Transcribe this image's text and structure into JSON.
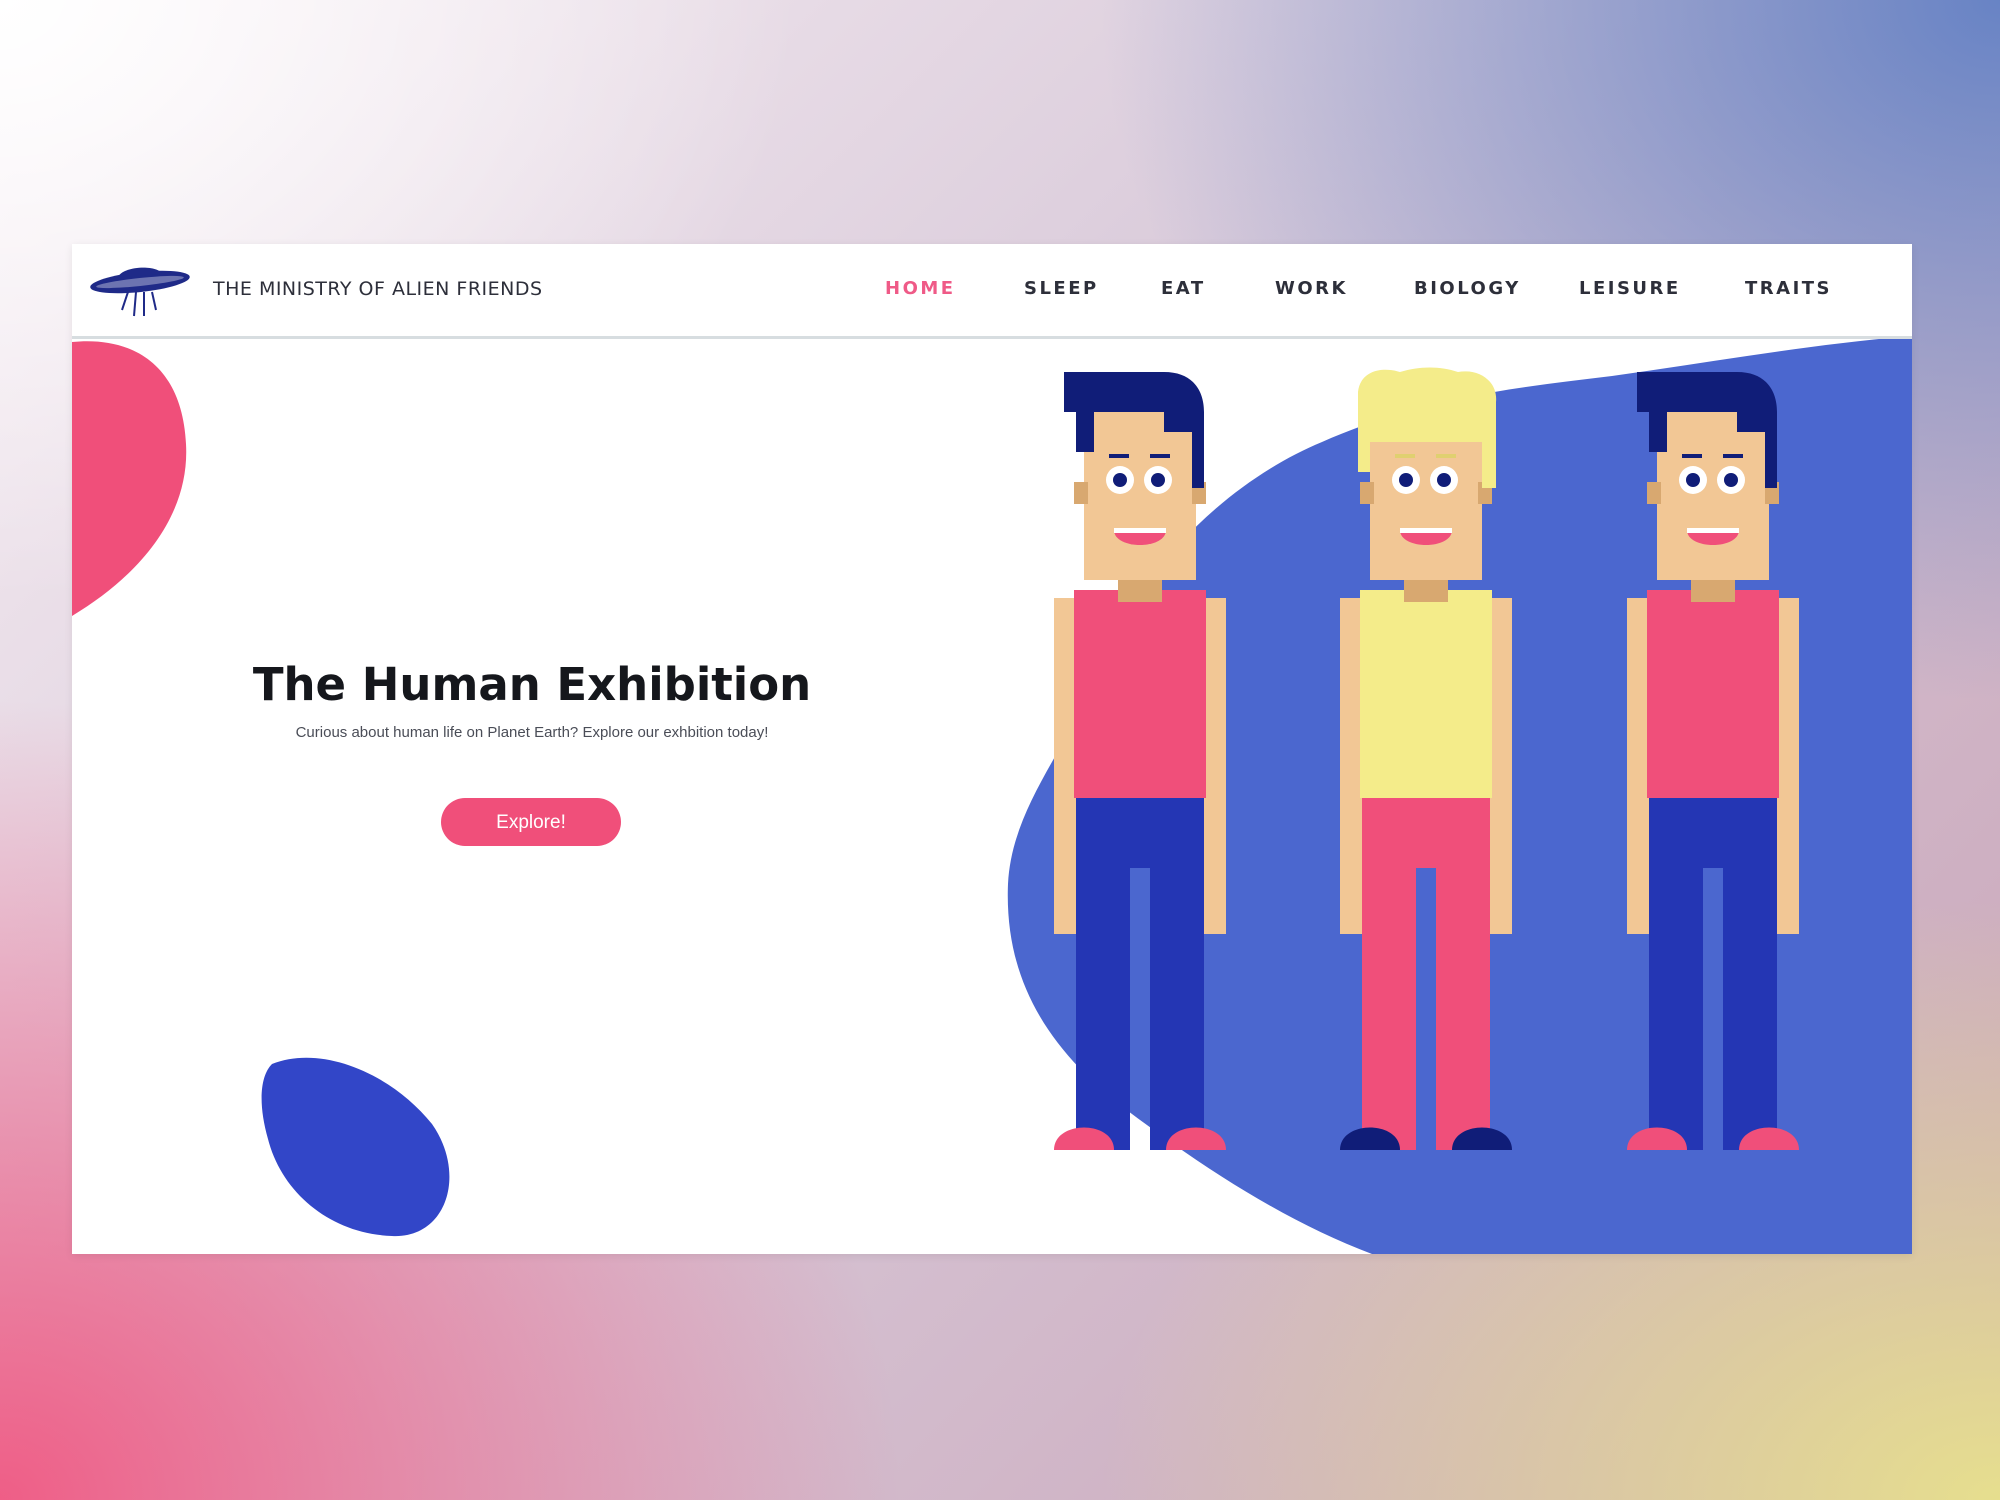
{
  "brand": {
    "name": "THE MINISTRY OF ALIEN FRIENDS",
    "logo_icon": "ufo-icon"
  },
  "nav": {
    "items": [
      {
        "label": "HOME",
        "active": true
      },
      {
        "label": "SLEEP",
        "active": false
      },
      {
        "label": "EAT",
        "active": false
      },
      {
        "label": "WORK",
        "active": false
      },
      {
        "label": "BIOLOGY",
        "active": false
      },
      {
        "label": "LEISURE",
        "active": false
      },
      {
        "label": "TRAITS",
        "active": false
      }
    ]
  },
  "hero": {
    "title": "The Human Exhibition",
    "subtitle": "Curious about human life on Planet Earth? Explore our exhbition today!",
    "cta_label": "Explore!"
  },
  "colors": {
    "accent": "#ef5a87",
    "blue_blob": "#4b67cf",
    "pink_blob": "#f04f7a",
    "navy": "#1f2a88",
    "skin": "#f2c795",
    "hair_dark": "#101d78",
    "hair_blond": "#f4ec8a"
  }
}
